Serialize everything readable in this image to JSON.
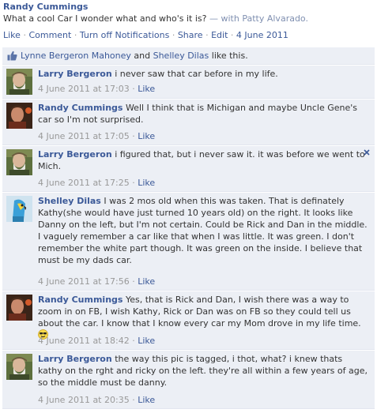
{
  "post": {
    "author": "Randy Cummings",
    "text": "What a cool Car I wonder what and who's it is?",
    "with_prefix": "— with",
    "with_name": "Patty Alvarado",
    "with_suffix": ".",
    "actions": {
      "like": "Like",
      "comment": "Comment",
      "notifications": "Turn off Notifications",
      "share": "Share",
      "edit": "Edit",
      "date": "4 June 2011",
      "separator": "·"
    }
  },
  "likes": {
    "person1": "Lynne Bergeron Mahoney",
    "and": "and",
    "person2": "Shelley Dilas",
    "suffix": "like this."
  },
  "comments": [
    {
      "author": "Larry Bergeron",
      "text": "i never saw that car before in my life.",
      "timestamp": "4 June 2011 at 17:03",
      "like": "Like",
      "separator": "·",
      "avatar": "larry-avatar",
      "has_close": false
    },
    {
      "author": "Randy Cummings",
      "text": "Well I think that is Michigan and maybe Uncle Gene's car so I'm not surprised.",
      "timestamp": "4 June 2011 at 17:05",
      "like": "Like",
      "separator": "·",
      "avatar": "randy-avatar",
      "has_close": false
    },
    {
      "author": "Larry Bergeron",
      "text": "i figured that, but i never saw it. it was before we went to Mich.",
      "timestamp": "4 June 2011 at 17:25",
      "like": "Like",
      "separator": "·",
      "avatar": "larry-avatar",
      "has_close": true
    },
    {
      "author": "Shelley Dilas",
      "text": "I was 2 mos old when this was taken. That is definately Kathy(she would have just turned 10 years old) on the right. It looks like Danny on the left, but I'm not certain. Could be Rick and Dan in the middle. I vaguely remember a car like that when I was little. It was green. I don't remember the white part though. It was green on the inside. I believe that must be my dads car.",
      "timestamp": "4 June 2011 at 17:56",
      "like": "Like",
      "separator": "·",
      "avatar": "shelley-avatar",
      "has_close": false
    },
    {
      "author": "Randy Cummings",
      "text": "Yes, that is Rick and Dan, I wish there was a way to zoom in on FB, I wish Kathy, Rick or Dan was on FB so they could tell us about the car. I know that I know every car my Mom drove in my life time.",
      "timestamp": "4 June 2011 at 18:42",
      "like": "Like",
      "separator": "·",
      "avatar": "randy-avatar",
      "has_close": false
    },
    {
      "author": "Larry Bergeron",
      "text": "the way this pic is tagged, i thot, what? i knew thats kathy on the rght and ricky on the left. they're all within a few years of age, so the middle must be danny.",
      "timestamp": "4 June 2011 at 20:35",
      "like": "Like",
      "separator": "·",
      "avatar": "larry-avatar",
      "has_close": false
    }
  ],
  "colors": {
    "link": "#3b5998",
    "comment_bg": "#eceff5",
    "meta_gray": "#999999"
  }
}
